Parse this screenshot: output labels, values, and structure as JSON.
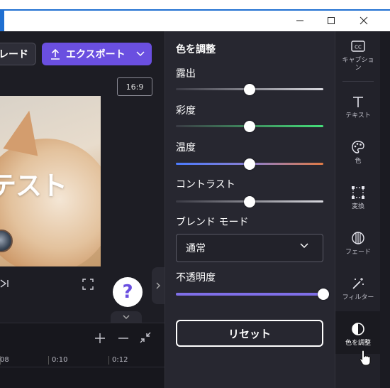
{
  "window": {
    "minimize_glyph": "—",
    "maximize_glyph": "☐",
    "close_glyph": "✕"
  },
  "toolbar": {
    "upgrade_label": "レード",
    "export_label": "エクスポート",
    "aspect_ratio": "16:9"
  },
  "preview": {
    "caption_text": "テスト"
  },
  "player": {
    "help_label": "?"
  },
  "timeline": {
    "ticks": [
      "08",
      "0:10",
      "0:12"
    ]
  },
  "adjust_panel": {
    "title": "色を調整",
    "sliders": [
      {
        "label": "露出",
        "value": 0.5
      },
      {
        "label": "彩度",
        "value": 0.5
      },
      {
        "label": "温度",
        "value": 0.5
      },
      {
        "label": "コントラスト",
        "value": 0.5
      }
    ],
    "blend_mode_label": "ブレンド モード",
    "blend_mode_value": "通常",
    "opacity_label": "不透明度",
    "opacity_value": 1.0,
    "reset_label": "リセット"
  },
  "rail": {
    "items": [
      {
        "label": "キャプション",
        "icon": "captions-icon"
      },
      {
        "label": "テキスト",
        "icon": "text-icon"
      },
      {
        "label": "色",
        "icon": "palette-icon"
      },
      {
        "label": "変換",
        "icon": "transform-icon"
      },
      {
        "label": "フェード",
        "icon": "fade-icon"
      },
      {
        "label": "フィルター",
        "icon": "filter-icon"
      },
      {
        "label": "色を調整",
        "icon": "adjust-color-icon",
        "active": true
      }
    ]
  },
  "colors": {
    "accent": "#6a4fe0",
    "saturation_track": "#45e07a",
    "temperature_cool": "#4b7bff",
    "temperature_warm": "#e07a45",
    "opacity_track": "#7f6fe8"
  }
}
